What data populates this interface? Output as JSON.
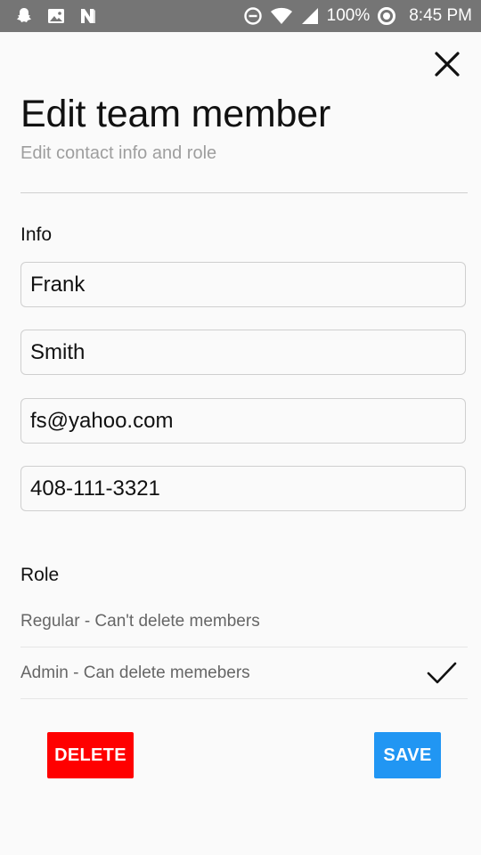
{
  "status_bar": {
    "battery": "100%",
    "time": "8:45 PM"
  },
  "header": {
    "title": "Edit team member",
    "subtitle": "Edit contact info and role"
  },
  "info": {
    "label": "Info",
    "fields": [
      {
        "value": "Frank"
      },
      {
        "value": "Smith"
      },
      {
        "value": "fs@yahoo.com"
      },
      {
        "value": "408-111-3321"
      }
    ]
  },
  "role": {
    "label": "Role",
    "options": [
      {
        "label": "Regular - Can't delete members",
        "selected": false
      },
      {
        "label": "Admin - Can delete memebers",
        "selected": true
      }
    ]
  },
  "actions": {
    "delete_label": "DELETE",
    "save_label": "SAVE"
  },
  "colors": {
    "status_bar": "#757575",
    "delete": "#ff0000",
    "save": "#2196f3",
    "background": "#fafafa"
  }
}
